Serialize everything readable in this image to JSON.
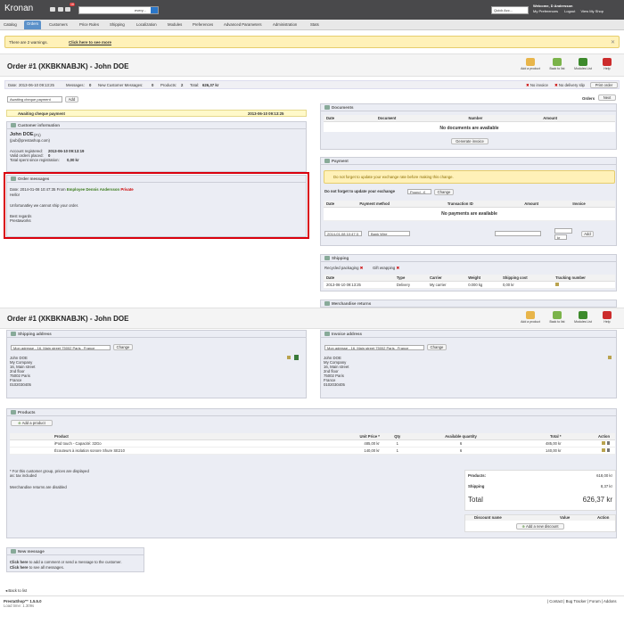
{
  "topbar": {
    "brand": "Kronan",
    "notif_count": "16",
    "search_scope": "every...",
    "quick_access": "Quick Acc...",
    "welcome": "Welcome, D Andersson",
    "my_preferences": "My Preferences",
    "logout": "Logout",
    "view_shop": "View My Shop"
  },
  "menu": [
    "Catalog",
    "Orders",
    "Customers",
    "Price Rules",
    "Shipping",
    "Localization",
    "Modules",
    "Preferences",
    "Advanced Parameters",
    "Administration",
    "Stats"
  ],
  "warning": {
    "text": "There are 2 warnings.",
    "link": "Click here to see more"
  },
  "header": {
    "title": "Order #1 (XKBKNABJK) - John DOE",
    "tools": [
      "Add a product",
      "Back to list",
      "Modules List",
      "Help"
    ]
  },
  "summary": {
    "date_label": "Date:",
    "date": "2013-06-10 09:13:25",
    "messages_label": "Messages:",
    "messages": "0",
    "new_msgs_label": "New Customer Messages:",
    "new_msgs": "0",
    "products_label": "Products:",
    "products": "2",
    "total_label": "Total:",
    "total": "626,37 kr",
    "no_invoice": "No invoice",
    "no_delivery": "No delivery slip",
    "print_order": "Print order"
  },
  "status": {
    "select": "Awaiting cheque payment",
    "add": "Add",
    "orders_label": "Orders",
    "next": "Next"
  },
  "history": {
    "state": "Awaiting cheque payment",
    "date": "2013-06-10 09:13:25"
  },
  "customer": {
    "header": "Customer information",
    "name": "John DOE",
    "id": "(#1)",
    "email": "(pub@prestashop.com)",
    "registered_label": "Account registered:",
    "registered": "2013-06-10 09:13:19",
    "valid_label": "Valid orders placed:",
    "valid": "0",
    "spent_label": "Total spent since registration:",
    "spent": "0,00 kr"
  },
  "messages": {
    "header": "Order messages",
    "meta_date": "Date: 2014-01-08 10:47:35",
    "meta_from": "From",
    "meta_role": "Employee",
    "meta_name": "Dennis Andersson",
    "meta_private": "Private",
    "lines": [
      "Hello!",
      "",
      "Unfortunatley we cannot ship your order.",
      "",
      "Best regards",
      "Prestaworks"
    ]
  },
  "documents": {
    "header": "Documents",
    "columns": [
      "Date",
      "Document",
      "Number",
      "Amount"
    ],
    "empty": "No documents are available",
    "generate": "Generate invoice"
  },
  "payment": {
    "header": "Payment",
    "warning": "Do not forget to update your exchange rate before making this change.",
    "currency_text": "Do not forget to update your exchange rate before making this change.",
    "currency_label": "Do not forget to update your exchange",
    "currency_sel": "Pound - £",
    "change": "Change",
    "columns": [
      "Date",
      "Payment method",
      "Transaction ID",
      "Amount",
      "Invoice"
    ],
    "empty": "No payments are available",
    "new_date": "2014-01-08 10:47:3",
    "new_method": "Bank Wire",
    "new_currency": "kr",
    "add": "Add"
  },
  "shipping": {
    "header": "Shipping",
    "recycled": "Recycled packaging",
    "gift": "Gift wrapping",
    "columns": [
      "Date",
      "Type",
      "Carrier",
      "Weight",
      "Shipping cost",
      "Tracking number"
    ],
    "rows": [
      [
        "2013-06-10 09:13:25",
        "Delivery",
        "My carrier",
        "0.000 kg",
        "0,00 kr",
        ""
      ]
    ]
  },
  "returns": {
    "header": "Merchandise returns"
  },
  "header2": {
    "title": "Order #1 (XKBKNABJK) - John DOE",
    "tools": [
      "Add a product",
      "Back to list",
      "Modules List",
      "Help"
    ]
  },
  "ship_addr": {
    "header": "Shipping address",
    "select": "Mon adresse - 16, Main street 75002 Paris , France",
    "change": "Change",
    "lines": [
      "John DOE",
      "My Company",
      "16, Main street",
      "2nd floor",
      "75002 Paris",
      "France",
      "0102030405"
    ]
  },
  "inv_addr": {
    "header": "Invoice address",
    "select": "Mon adresse - 16, Main street 75002 Paris , France",
    "change": "Change",
    "lines": [
      "John DOE",
      "My Company",
      "16, Main street",
      "2nd floor",
      "75002 Paris",
      "France",
      "0102030405"
    ]
  },
  "products": {
    "header": "Products",
    "add": "Add a product",
    "columns": [
      "Product",
      "Unit Price *",
      "Qty",
      "Available quantity",
      "Total *",
      "Action"
    ],
    "rows": [
      [
        "iPod touch - Capacité: 32Go",
        "485,00 kr",
        "1",
        "6",
        "485,00 kr"
      ],
      [
        "Écouteurs à isolation sonore Shure SE210",
        "140,00 kr",
        "1",
        "6",
        "140,00 kr"
      ]
    ],
    "note1": "* For this customer group, prices are displayed",
    "note2": "as: tax included",
    "note3": "Merchandise returns are disabled"
  },
  "totals": {
    "products_label": "Products:",
    "products": "618,00 kr",
    "shipping_label": "Shipping",
    "shipping": "8,37 kr",
    "total_label": "Total",
    "total": "626,37 kr"
  },
  "discount": {
    "cols": [
      "Discount name",
      "Value",
      "Action"
    ],
    "add": "Add a new discount"
  },
  "newmsg": {
    "header": "New message",
    "line1a": "Click here",
    "line1b": "to add a comment or send a message to the customer.",
    "line2a": "Click here",
    "line2b": "to see all messages."
  },
  "footer": {
    "back": "Back to list",
    "version": "PrestaShop™ 1.5.5.0",
    "load": "Load time: 1.309s",
    "links": "| Contact | Bug Tracker | Forum | Addons"
  }
}
